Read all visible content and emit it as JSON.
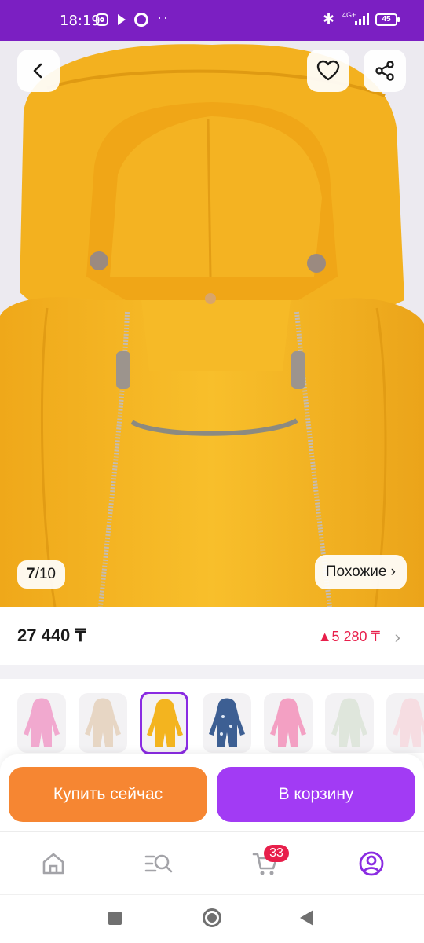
{
  "status_bar": {
    "time": "18:19",
    "network": "4G+",
    "battery": "45",
    "icons": [
      "instagram-icon",
      "play-icon",
      "circle-icon",
      "more-dots-icon",
      "bluetooth-icon",
      "signal-icon",
      "battery-icon"
    ]
  },
  "gallery": {
    "current": "7",
    "separator": "/",
    "total": "10",
    "similar_label": "Похожие ›",
    "colors": {
      "product": "#f5b521",
      "background": "#eceaf0"
    }
  },
  "header_actions": {
    "icons": [
      "back-arrow-icon",
      "heart-icon",
      "share-icon"
    ]
  },
  "price": {
    "current": "27 440 ₸",
    "change": "▲5 280 ₸",
    "change_color": "#e81f4b"
  },
  "variants": {
    "items": [
      {
        "name": "pink",
        "color": "#f1a9cf"
      },
      {
        "name": "beige",
        "color": "#e7d6c4"
      },
      {
        "name": "yellow",
        "color": "#f3b41f",
        "selected": true
      },
      {
        "name": "blue-print",
        "color": "#3d5f93"
      },
      {
        "name": "pink-light",
        "color": "#f3a0c3"
      },
      {
        "name": "mint",
        "color": "#dfe6dc"
      },
      {
        "name": "pale-pink",
        "color": "#f6dde2"
      }
    ]
  },
  "actions": {
    "buy_now": "Купить сейчас",
    "add_to_cart": "В корзину",
    "buy_color": "#f68632",
    "cart_color": "#a23bf4"
  },
  "bottom_nav": {
    "items": [
      "home-icon",
      "catalog-search-icon",
      "cart-icon",
      "profile-icon"
    ],
    "cart_count": "33",
    "active_color": "#8a2be2"
  },
  "system_nav": {
    "icons": [
      "recents-icon",
      "home-circle-icon",
      "back-triangle-icon"
    ]
  }
}
